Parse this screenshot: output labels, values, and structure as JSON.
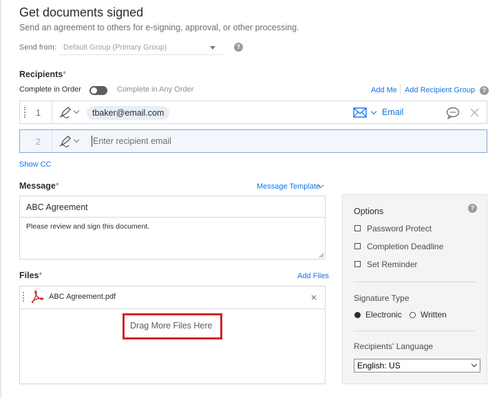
{
  "header": {
    "title": "Get documents signed",
    "subtitle": "Send an agreement to others for e-signing, approval, or other processing."
  },
  "send_from": {
    "label": "Send from:",
    "value": "Default Group (Primary Group)"
  },
  "recipients": {
    "label": "Recipients",
    "required_mark": "*",
    "complete_in_order": "Complete in Order",
    "complete_in_any_order": "Complete in Any Order",
    "add_me": "Add Me",
    "add_recipient_group": "Add Recipient Group",
    "rows": [
      {
        "number": "1",
        "email": "tbaker@email.com",
        "auth_method": "Email"
      },
      {
        "number": "2",
        "placeholder": "Enter recipient email"
      }
    ],
    "show_cc": "Show CC"
  },
  "message": {
    "label": "Message",
    "required_mark": "*",
    "template_link": "Message Template",
    "title_value": "ABC Agreement",
    "body_value": "Please review and sign this document."
  },
  "files": {
    "label": "Files",
    "required_mark": "*",
    "add_files": "Add Files",
    "items": [
      {
        "name": "ABC Agreement.pdf"
      }
    ],
    "drop_text": "Drag More Files Here"
  },
  "options": {
    "title": "Options",
    "items": [
      "Password Protect",
      "Completion Deadline",
      "Set Reminder"
    ],
    "signature_type_label": "Signature Type",
    "signature_types": [
      "Electronic",
      "Written"
    ],
    "selected_signature_type": "Electronic",
    "language_label": "Recipients' Language",
    "language_value": "English: US"
  },
  "colors": {
    "link": "#1473e6",
    "highlight_border": "#d3202a",
    "pdf_icon": "#d3202a",
    "active_row_border": "#7fa6d6"
  },
  "icons": [
    "help-icon",
    "signer-pen-icon",
    "envelope-icon",
    "chat-bubble-icon",
    "close-icon",
    "pdf-icon",
    "resize-grip-icon"
  ]
}
